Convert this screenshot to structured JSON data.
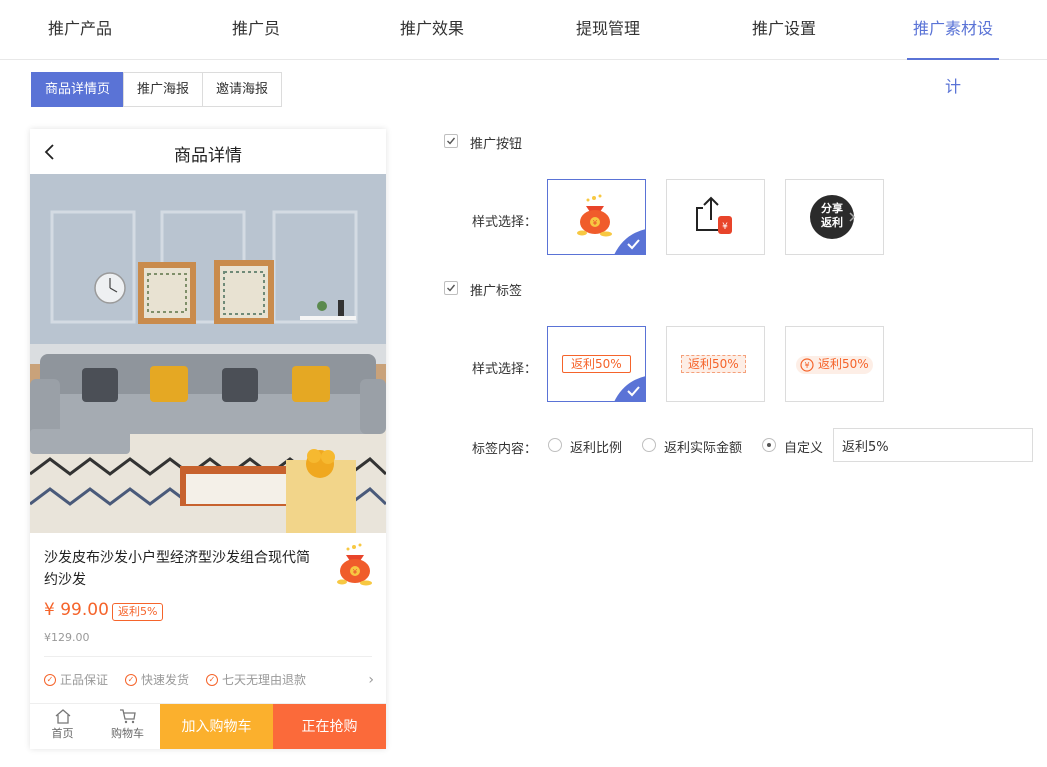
{
  "topnav": {
    "tabs": [
      {
        "label": "推广产品"
      },
      {
        "label": "推广员"
      },
      {
        "label": "推广效果"
      },
      {
        "label": "提现管理"
      },
      {
        "label": "推广设置"
      },
      {
        "label": "推广素材设计"
      }
    ],
    "active_index": 5
  },
  "subtabs": {
    "items": [
      {
        "label": "商品详情页"
      },
      {
        "label": "推广海报"
      },
      {
        "label": "邀请海报"
      }
    ],
    "active_index": 0
  },
  "phone": {
    "header_title": "商品详情",
    "product_name": "沙发皮布沙发小户型经济型沙发组合现代简约沙发",
    "price": "¥ 99.00",
    "rebate_tag": "返利5%",
    "original_price": "¥129.00",
    "assurances": [
      "正品保证",
      "快速发货",
      "七天无理由退款"
    ],
    "nav_home": "首页",
    "nav_cart": "购物车",
    "add_cart": "加入购物车",
    "buy_now": "正在抢购"
  },
  "settings": {
    "promo_button": {
      "label": "推广按钮",
      "checked": true
    },
    "style_label": "样式选择：",
    "share_text_line1": "分享",
    "share_text_line2": "返利",
    "promo_tag": {
      "label": "推广标签",
      "checked": true
    },
    "tag_style_text": "返利50%",
    "tag_content": {
      "label": "标签内容：",
      "options": [
        "返利比例",
        "返利实际金额",
        "自定义"
      ],
      "selected_index": 2,
      "custom_value": "返利5%"
    }
  },
  "colors": {
    "accent": "#5a73d6",
    "orange": "#f5642b",
    "cart_button": "#fbb02d",
    "buy_button": "#fb6a3a"
  }
}
